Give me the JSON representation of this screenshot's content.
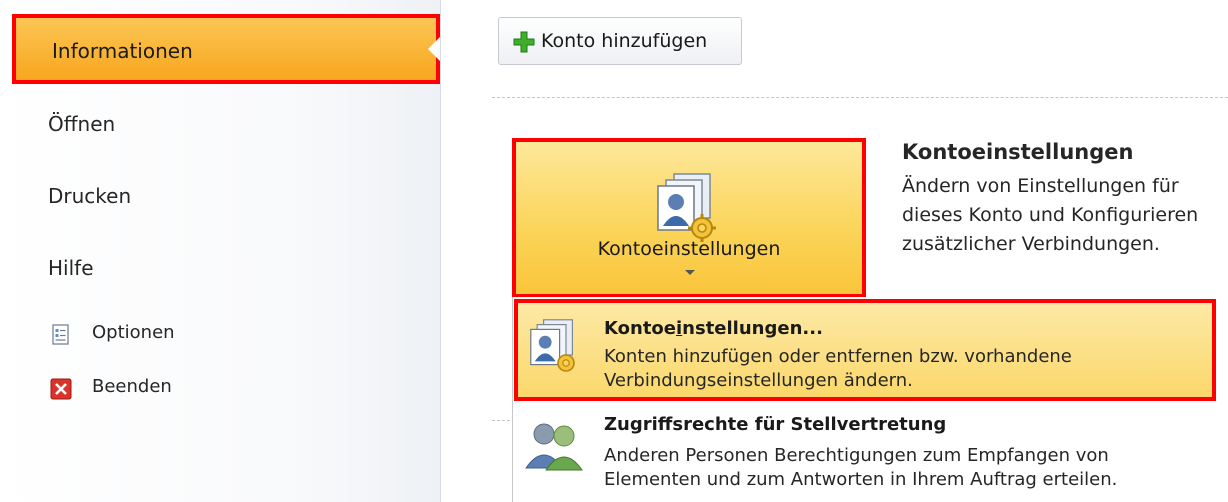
{
  "nav": {
    "items": [
      {
        "label": "Informationen",
        "selected": true
      },
      {
        "label": "Öffnen"
      },
      {
        "label": "Drucken"
      },
      {
        "label": "Hilfe"
      },
      {
        "label": "Optionen",
        "icon": "options-icon"
      },
      {
        "label": "Beenden",
        "icon": "exit-icon"
      }
    ]
  },
  "main": {
    "add_account_label": "Konto hinzufügen",
    "account_settings": {
      "button_label": "Kontoeinstellungen",
      "title": "Kontoeinstellungen",
      "description_lines": [
        "Ändern von Einstellungen für",
        "dieses Konto und Konfigurieren",
        "zusätzlicher Verbindungen."
      ]
    },
    "dropdown": {
      "items": [
        {
          "title_parts": [
            "Kontoe",
            "i",
            "nstellungen..."
          ],
          "description_lines": [
            "Konten hinzufügen oder entfernen bzw. vorhandene",
            "Verbindungseinstellungen ändern."
          ],
          "icon": "account-settings-icon",
          "highlighted": true
        },
        {
          "title": "Zugriffsrechte für Stellvertretung",
          "description_lines": [
            "Anderen Personen Berechtigungen zum Empfangen von",
            "Elementen und zum Antworten in Ihrem Auftrag erteilen."
          ],
          "icon": "delegate-access-icon"
        }
      ]
    }
  },
  "colors": {
    "highlight_border": "#ff0000",
    "selected_nav_gradient_top": "#fbc655",
    "selected_nav_gradient_bottom": "#f8a61e",
    "button_highlight": "#fbd55c"
  }
}
